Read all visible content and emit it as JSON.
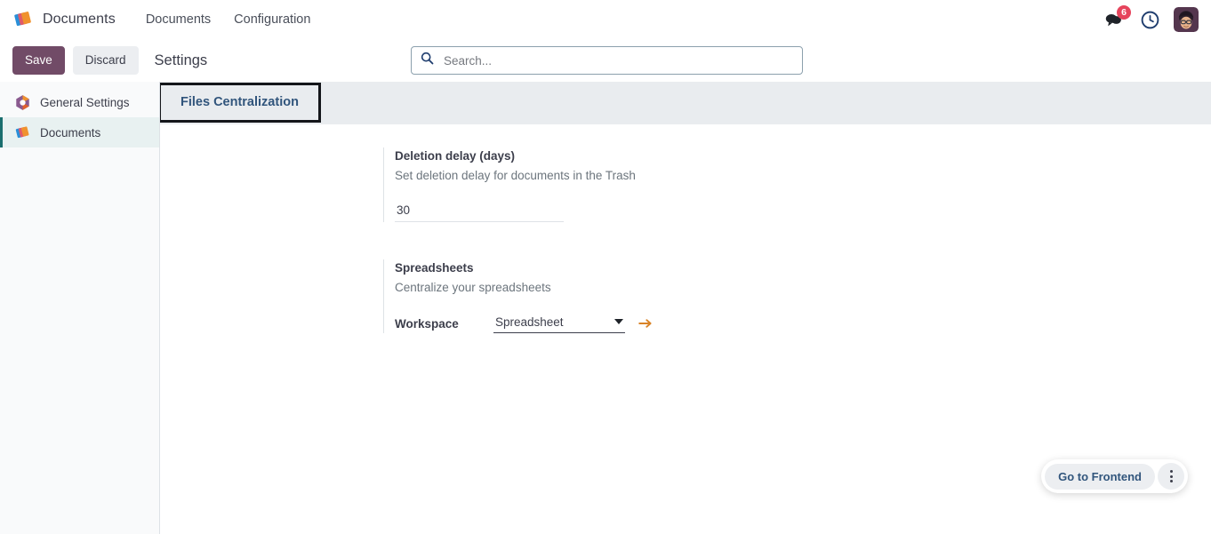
{
  "navbar": {
    "brand": "Documents",
    "logo_icon": "documents-logo-icon",
    "menu": [
      {
        "label": "Documents",
        "name": "nav-item-documents"
      },
      {
        "label": "Configuration",
        "name": "nav-item-configuration"
      }
    ],
    "messages_icon": "messages-icon",
    "messages_count": "6",
    "activities_icon": "clock-activities-icon",
    "avatar_icon": "user-avatar"
  },
  "control_panel": {
    "save_label": "Save",
    "discard_label": "Discard",
    "breadcrumb": "Settings",
    "search_placeholder": "Search...",
    "search_value": "",
    "search_icon": "search-icon"
  },
  "sidebar": {
    "items": [
      {
        "label": "General Settings",
        "icon": "general-settings-icon",
        "active": false
      },
      {
        "label": "Documents",
        "icon": "documents-logo-icon",
        "active": true
      }
    ]
  },
  "tabs": [
    {
      "label": "Files Centralization",
      "active": true
    }
  ],
  "settings": {
    "blocks": [
      {
        "title": "Deletion delay (days)",
        "description": "Set deletion delay for documents in the Trash",
        "field_type": "number",
        "field_value": "30"
      },
      {
        "title": "Spreadsheets",
        "description": "Centralize your spreadsheets",
        "field_type": "select",
        "field_label": "Workspace",
        "field_value": "Spreadsheet",
        "caret_icon": "chevron-down-icon",
        "internal_link_icon": "arrow-right-internal-link-icon"
      }
    ]
  },
  "frontend_widget": {
    "button_label": "Go to Frontend",
    "kebab_icon": "kebab-menu-icon"
  },
  "colors": {
    "brand_purple": "#714B67",
    "badge_red": "#e6445c",
    "active_teal": "#1a6e6e",
    "tab_blue": "#31557c"
  }
}
